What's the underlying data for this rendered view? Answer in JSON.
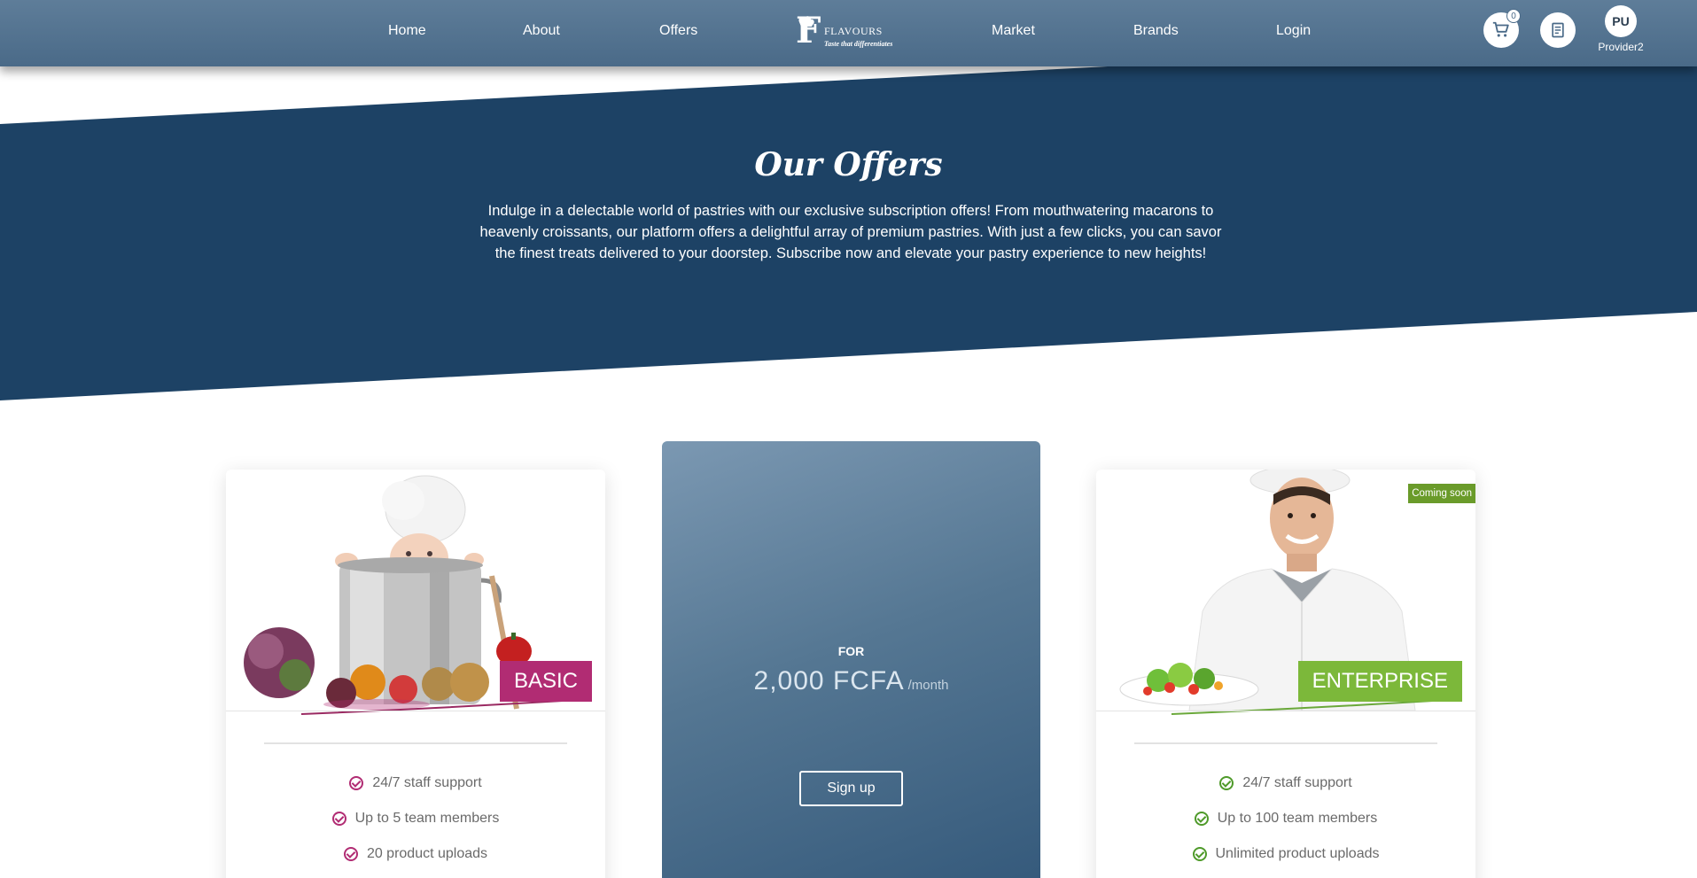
{
  "nav": {
    "home": "Home",
    "about": "About",
    "offers": "Offers",
    "market": "Market",
    "brands": "Brands",
    "login": "Login"
  },
  "logo": {
    "letter": "F",
    "name": "FLAVOURS",
    "tagline": "Taste that differentiates"
  },
  "header": {
    "cart_count": "0",
    "avatar_initials": "PU",
    "username": "Provider2"
  },
  "hero": {
    "title": "Our Offers",
    "text": "Indulge in a delectable world of pastries with our exclusive subscription offers! From mouthwatering macarons to heavenly croissants, our platform offers a delightful array of premium pastries. With just a few clicks, you can savor the finest treats delivered to your doorstep. Subscribe now and elevate your pastry experience to new heights!"
  },
  "plans": {
    "basic": {
      "label": "BASIC",
      "color": "#b12c73",
      "features": [
        "24/7 staff support",
        "Up to 5 team members",
        "20 product uploads"
      ]
    },
    "featured": {
      "for_label": "FOR",
      "price": "2,000 FCFA",
      "period": "/month",
      "signup_label": "Sign up"
    },
    "enterprise": {
      "label": "ENTERPRISE",
      "color": "#7cb83a",
      "badge": "Coming soon",
      "features": [
        "24/7 staff support",
        "Up to 100 team members",
        "Unlimited product uploads"
      ]
    }
  },
  "colors": {
    "header": "#4f6f8d",
    "hero": "#1d4265",
    "check_basic": "#b12c73",
    "check_enterprise": "#6aa83a"
  }
}
